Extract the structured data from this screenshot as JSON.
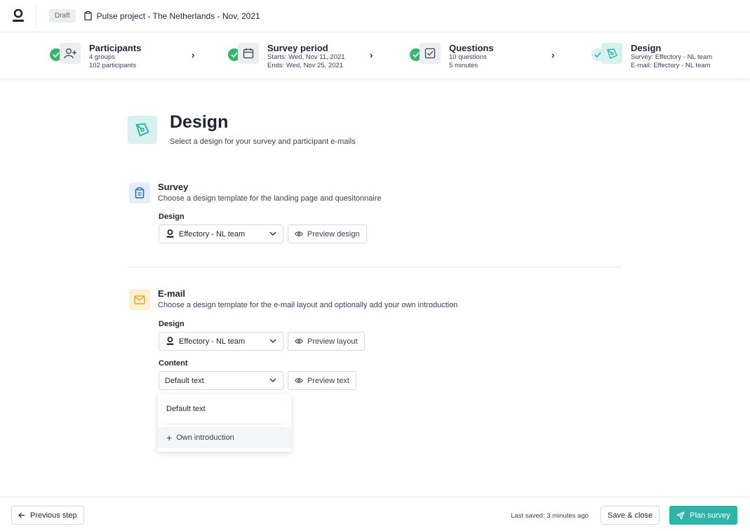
{
  "header": {
    "status_badge": "Draft",
    "project_title": "Pulse project - The Netherlands - Nov, 2021"
  },
  "steps": [
    {
      "title": "Participants",
      "line1": "4 groups",
      "line2": "102 participants",
      "icon": "add-user-icon",
      "done": true
    },
    {
      "title": "Survey period",
      "line1": "Starts: Wed, Nov 11, 2021",
      "line2": "Ends: Wed, Nov 25, 2021",
      "icon": "calendar-icon",
      "done": true
    },
    {
      "title": "Questions",
      "line1": "10 questions",
      "line2": "5 minutes",
      "icon": "checkbox-icon",
      "done": true
    },
    {
      "title": "Design",
      "line1": "Survey: Effectory - NL team",
      "line2": "E-mail: Effectory - NL team",
      "icon": "pen-tool-icon",
      "done": false,
      "active": true
    }
  ],
  "page": {
    "title": "Design",
    "subtitle": "Select a design for your survey and participant e-mails"
  },
  "survey_section": {
    "title": "Survey",
    "subtitle": "Choose a design template for the landing page and quesitonnaire",
    "design_label": "Design",
    "design_value": "Effectory - NL team",
    "preview_label": "Preview design"
  },
  "email_section": {
    "title": "E-mail",
    "subtitle": "Choose a design template for the e-mail layout and optionally add your own introduction",
    "design_label": "Design",
    "design_value": "Effectory - NL team",
    "preview_layout_label": "Preview layout",
    "content_label": "Content",
    "content_value": "Default text",
    "preview_text_label": "Preview text",
    "content_options": [
      "Default text",
      "Own introduction"
    ]
  },
  "footer": {
    "previous_label": "Previous step",
    "last_saved": "Last saved: 3 minutes ago",
    "save_close_label": "Save & close",
    "plan_label": "Plan survey"
  },
  "colors": {
    "accent": "#2fb5a7",
    "success": "#3cb371",
    "accent_light": "#d6f1ee"
  }
}
